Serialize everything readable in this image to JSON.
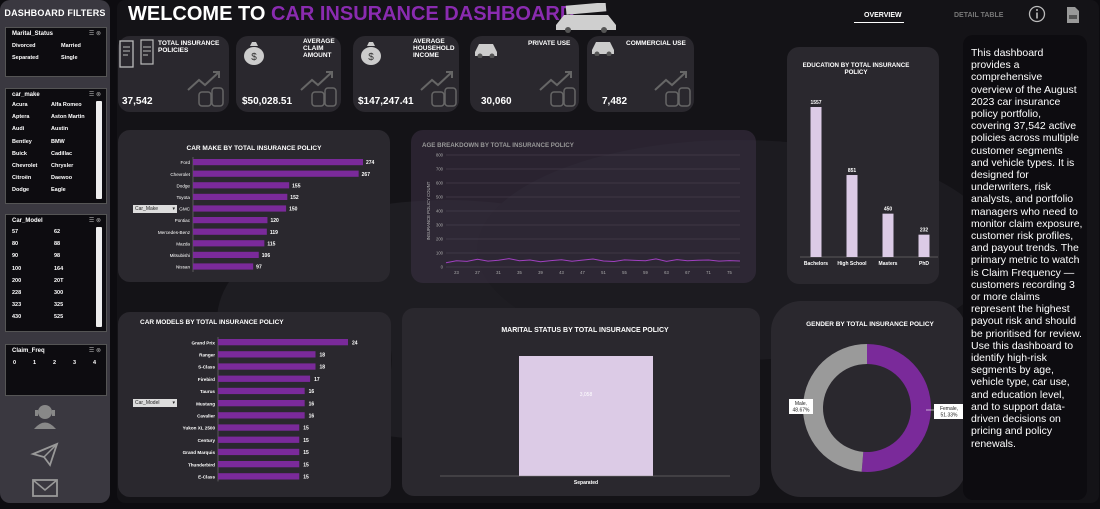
{
  "sidebar": {
    "title": "DASHBOARD FILTERS",
    "marital": {
      "header": "Marital_Status",
      "items": [
        "Divorced",
        "Married",
        "Separated",
        "Single"
      ]
    },
    "car_make": {
      "header": "car_make",
      "items": [
        "Acura",
        "Alfa Romeo",
        "Aptera",
        "Aston Martin",
        "Audi",
        "Austin",
        "Bentley",
        "BMW",
        "Buick",
        "Cadillac",
        "Chevrolet",
        "Chrysler",
        "Citroën",
        "Daewoo",
        "Dodge",
        "Eagle"
      ]
    },
    "car_model": {
      "header": "Car_Model",
      "items": [
        "57",
        "62",
        "80",
        "88",
        "90",
        "98",
        "100",
        "164",
        "200",
        "20T",
        "228",
        "300",
        "323",
        "325",
        "430",
        "525"
      ]
    },
    "claim_freq": {
      "header": "Claim_Freq",
      "items": [
        "0",
        "1",
        "2",
        "3",
        "4"
      ]
    }
  },
  "header": {
    "title_white": "WELCOME TO",
    "title_purple": "CAR INSURANCE DASHBOARD",
    "tab_overview": "OVERVIEW",
    "tab_detail": "DETAIL TABLE"
  },
  "kpis": [
    {
      "label": "TOTAL INSURANCE POLICIES",
      "value": "37,542"
    },
    {
      "label": "AVERAGE CLAIM AMOUNT",
      "value": "$50,028.51"
    },
    {
      "label": "AVERAGE HOUSEHOLD INCOME",
      "value": "$147,247.41"
    },
    {
      "label": "PRIVATE USE",
      "value": "30,060"
    },
    {
      "label": "COMMERCIAL USE",
      "value": "7,482"
    }
  ],
  "description": "This dashboard provides a comprehensive overview of the August 2023 car insurance policy portfolio, covering 37,542 active policies across multiple customer segments and vehicle types. It is designed for underwriters, risk analysts, and portfolio managers who need to monitor claim exposure, customer risk profiles, and payout trends. The primary metric to watch is Claim Frequency — customers recording 3 or more claims represent the highest payout risk and should be prioritised for review. Use this dashboard to identify high-risk segments by age, vehicle type, car use, and education level, and to support data-driven decisions on pricing and policy renewals.",
  "filters": {
    "car_make_dropdown": "Car_Make",
    "car_model_dropdown": "Car_Model"
  },
  "colors": {
    "accent": "#7a2a9a",
    "light_purple": "#dccbe6",
    "grey": "#9a9a9a"
  },
  "chart_data": [
    {
      "type": "bar",
      "orientation": "horizontal",
      "title": "CAR MAKE BY TOTAL INSURANCE POLICY",
      "categories": [
        "Ford",
        "Chevrolet",
        "Dodge",
        "Toyota",
        "GMC",
        "Pontiac",
        "Mercedes-Benz",
        "Mazda",
        "Mitsubishi",
        "Nissan"
      ],
      "values": [
        274,
        267,
        155,
        152,
        150,
        120,
        119,
        115,
        106,
        97
      ]
    },
    {
      "type": "line",
      "title": "AGE BREAKDOWN BY TOTAL INSURANCE POLICY",
      "ylabel": "INSURANCE POLICY COUNT",
      "ylim": [
        0,
        800
      ],
      "yticks": [
        0,
        100,
        200,
        300,
        400,
        500,
        600,
        700,
        800
      ],
      "xticks": [
        23,
        27,
        31,
        35,
        39,
        43,
        47,
        51,
        55,
        59,
        63,
        67,
        71,
        75
      ],
      "x": [
        21,
        23,
        25,
        27,
        29,
        31,
        33,
        35,
        37,
        39,
        41,
        43,
        45,
        47,
        49,
        51,
        53,
        55,
        57,
        59,
        61,
        63,
        65,
        67,
        69,
        71,
        73,
        75,
        77
      ],
      "values": [
        30,
        45,
        40,
        55,
        42,
        48,
        60,
        44,
        50,
        38,
        46,
        52,
        41,
        49,
        57,
        43,
        39,
        51,
        47,
        45,
        58,
        40,
        53,
        44,
        48,
        50,
        42,
        46,
        43
      ]
    },
    {
      "type": "bar",
      "title": "EDUCATION BY TOTAL INSURANCE POLICY",
      "categories": [
        "Bachelors",
        "High School",
        "Masters",
        "PhD"
      ],
      "values": [
        1557,
        851,
        450,
        232
      ]
    },
    {
      "type": "bar",
      "orientation": "horizontal",
      "title": "CAR MODELS BY TOTAL INSURANCE POLICY",
      "categories": [
        "Grand Prix",
        "Ranger",
        "S-Class",
        "Firebird",
        "Taurus",
        "Mustang",
        "Cavalier",
        "Yukon XL 2500",
        "Century",
        "Grand Marquis",
        "Thunderbird",
        "E-Class"
      ],
      "values": [
        24,
        18,
        18,
        17,
        16,
        16,
        16,
        15,
        15,
        15,
        15,
        15
      ]
    },
    {
      "type": "bar",
      "title": "MARITAL STATUS BY TOTAL INSURANCE POLICY",
      "categories": [
        "Separated"
      ],
      "values": [
        3058
      ]
    },
    {
      "type": "pie",
      "title": "GENDER BY TOTAL INSURANCE POLICY",
      "categories": [
        "Female",
        "Male"
      ],
      "values": [
        51.33,
        48.67
      ],
      "labels": [
        "Female, 51.33%",
        "Male, 48.67%"
      ]
    }
  ]
}
